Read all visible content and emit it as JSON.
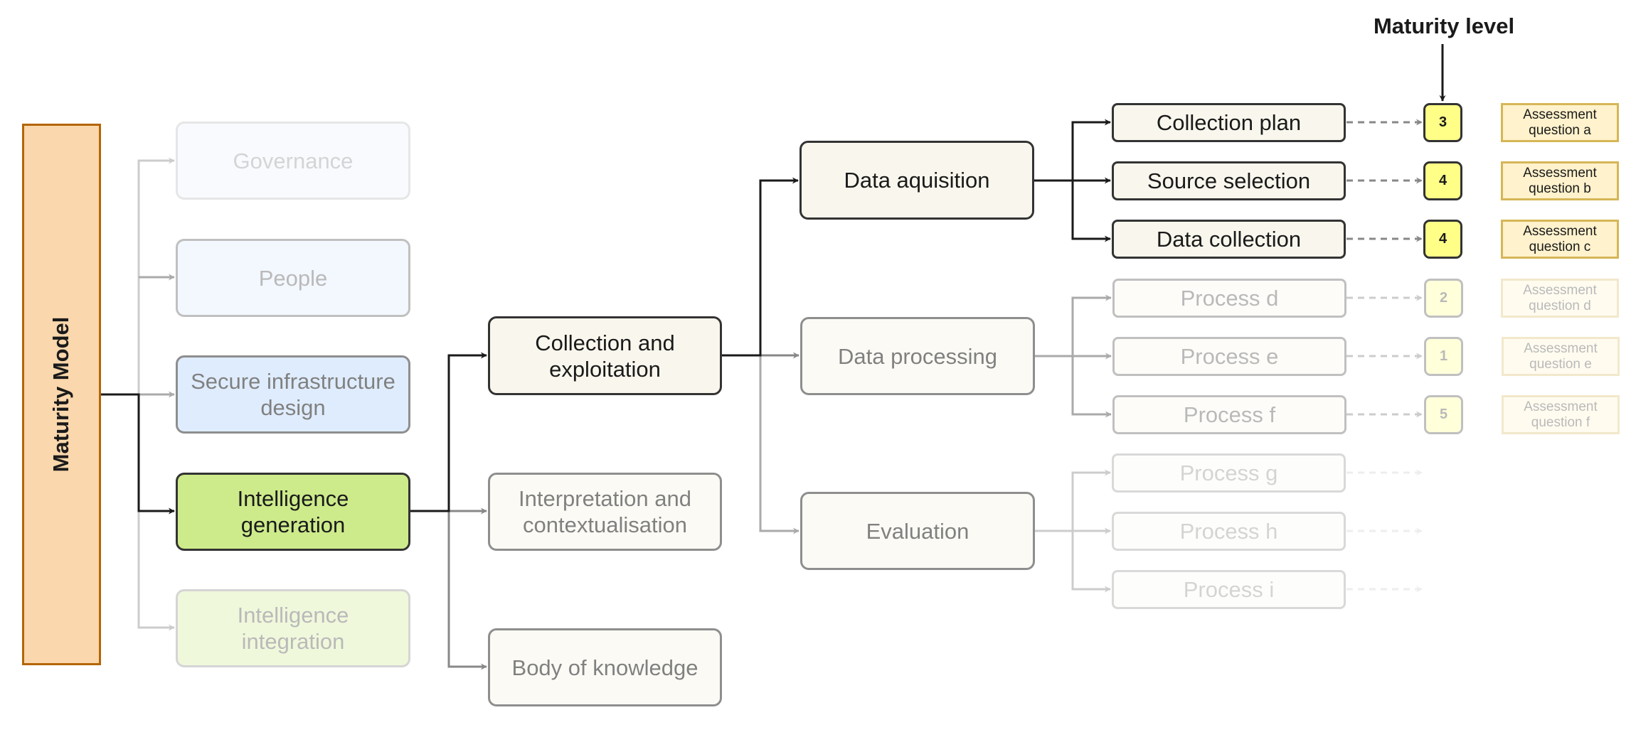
{
  "diagram": {
    "root": {
      "label": "Maturity Model",
      "fill": "#fad7ac",
      "stroke": "#b46504"
    },
    "maturity_level_title": "Maturity level",
    "domains": [
      {
        "id": "governance",
        "label": "Governance",
        "fill": "#dae8fc",
        "state": "inactive"
      },
      {
        "id": "people",
        "label": "People",
        "fill": "#dae8fc",
        "state": "inactive"
      },
      {
        "id": "secure-infrastructure",
        "label": "Secure infrastructure\ndesign",
        "fill": "#dae8fc",
        "state": "semi"
      },
      {
        "id": "intelligence-generation",
        "label": "Intelligence\ngeneration",
        "fill": "#cdeb8b",
        "state": "active"
      },
      {
        "id": "intelligence-integration",
        "label": "Intelligence\nintegration",
        "fill": "#cdeb8b",
        "state": "inactive"
      }
    ],
    "subdomains": [
      {
        "id": "collection-exploitation",
        "label": "Collection and\nexploitation",
        "state": "active"
      },
      {
        "id": "interpretation",
        "label": "Interpretation and\ncontextualisation",
        "state": "inactive"
      },
      {
        "id": "body-of-knowledge",
        "label": "Body of knowledge",
        "state": "inactive"
      }
    ],
    "capabilities": [
      {
        "id": "data-aquisition",
        "label": "Data aquisition",
        "state": "active"
      },
      {
        "id": "data-processing",
        "label": "Data processing",
        "state": "inactive"
      },
      {
        "id": "evaluation",
        "label": "Evaluation",
        "state": "inactive"
      }
    ],
    "processes": [
      {
        "label": "Collection plan",
        "level": "3",
        "question": "Assessment\nquestion a",
        "state": "active"
      },
      {
        "label": "Source selection",
        "level": "4",
        "question": "Assessment\nquestion b",
        "state": "active"
      },
      {
        "label": "Data collection",
        "level": "4",
        "question": "Assessment\nquestion c",
        "state": "active"
      },
      {
        "label": "Process d",
        "level": "2",
        "question": "Assessment\nquestion d",
        "state": "inactive"
      },
      {
        "label": "Process e",
        "level": "1",
        "question": "Assessment\nquestion e",
        "state": "inactive"
      },
      {
        "label": "Process f",
        "level": "5",
        "question": "Assessment\nquestion f",
        "state": "inactive"
      },
      {
        "label": "Process g",
        "level": null,
        "question": null,
        "state": "hidden"
      },
      {
        "label": "Process h",
        "level": null,
        "question": null,
        "state": "hidden"
      },
      {
        "label": "Process i",
        "level": null,
        "question": null,
        "state": "hidden"
      }
    ],
    "colors": {
      "node_fill": "#f9f7ed",
      "level_fill": "#ffff88",
      "question_fill": "#fff2cc",
      "question_stroke": "#d6b656",
      "edge": "#1a1a1a"
    }
  }
}
